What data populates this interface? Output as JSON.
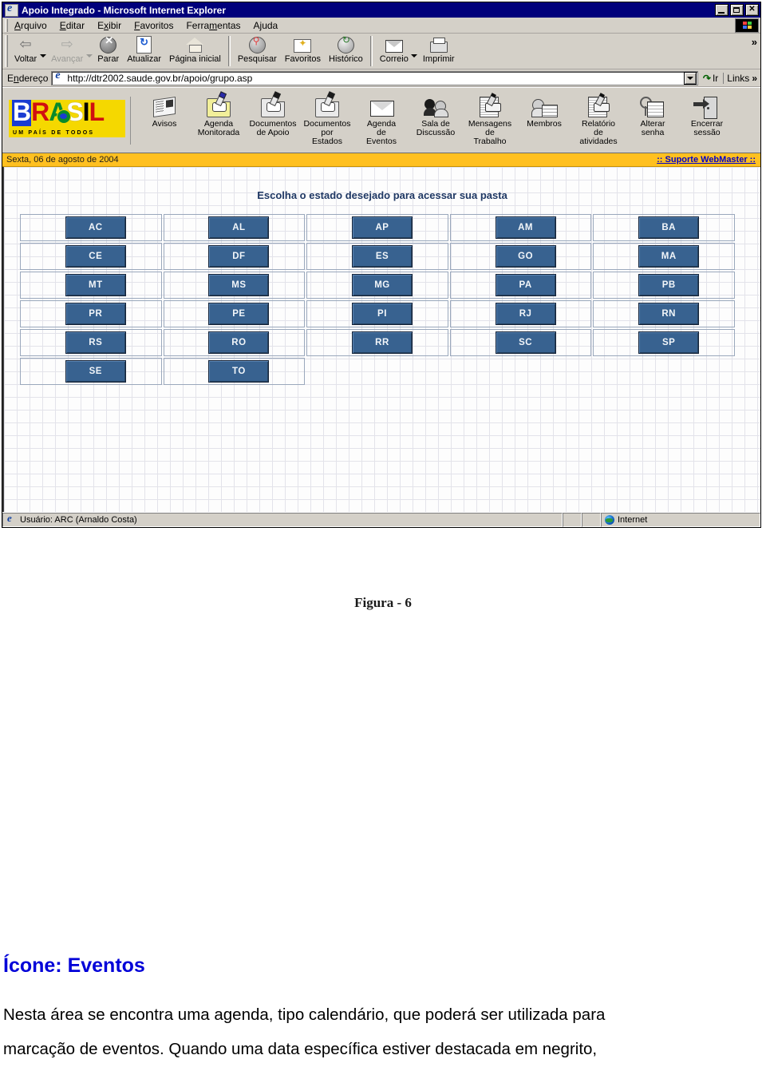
{
  "window": {
    "title": "Apoio Integrado - Microsoft Internet Explorer",
    "icon": "ie-document-icon",
    "controls": {
      "minimize": "minimize-button",
      "restore": "restore-button",
      "close": "close-button",
      "close_glyph": "✕"
    }
  },
  "menubar": {
    "items": [
      {
        "label": "Arquivo",
        "mnemonic": "A"
      },
      {
        "label": "Editar",
        "mnemonic": "E"
      },
      {
        "label": "Exibir",
        "mnemonic": "x"
      },
      {
        "label": "Favoritos",
        "mnemonic": "F"
      },
      {
        "label": "Ferramentas",
        "mnemonic": "m"
      },
      {
        "label": "Ajuda",
        "mnemonic": "j"
      }
    ],
    "logo_button": "ie-animated-logo"
  },
  "toolbar": {
    "buttons": [
      {
        "label": "Voltar",
        "icon": "back-arrow-icon",
        "enabled": true,
        "has_dropdown": true
      },
      {
        "label": "Avançar",
        "icon": "forward-arrow-icon",
        "enabled": false,
        "has_dropdown": true
      },
      {
        "label": "Parar",
        "icon": "stop-icon",
        "enabled": true,
        "has_dropdown": false
      },
      {
        "label": "Atualizar",
        "icon": "refresh-icon",
        "enabled": true,
        "has_dropdown": false
      },
      {
        "label": "Página inicial",
        "icon": "home-icon",
        "enabled": true,
        "has_dropdown": false
      },
      {
        "label": "Pesquisar",
        "icon": "search-icon",
        "enabled": true,
        "has_dropdown": false
      },
      {
        "label": "Favoritos",
        "icon": "favorites-star-folder-icon",
        "enabled": true,
        "has_dropdown": false
      },
      {
        "label": "Histórico",
        "icon": "history-clock-icon",
        "enabled": true,
        "has_dropdown": false
      },
      {
        "label": "Correio",
        "icon": "mail-icon",
        "enabled": true,
        "has_dropdown": true
      },
      {
        "label": "Imprimir",
        "icon": "printer-icon",
        "enabled": true,
        "has_dropdown": false
      }
    ],
    "overflow_chevron": "»"
  },
  "addressbar": {
    "label": "Endereço",
    "url": "http://dtr2002.saude.gov.br/apoio/grupo.asp",
    "go_label": "Ir",
    "go_arrow": "↷",
    "links_label": "Links",
    "links_chevron": "»",
    "icon": "ie-page-icon"
  },
  "app": {
    "logo": {
      "letters": [
        "B",
        "R",
        "A",
        "S",
        "I",
        "L"
      ],
      "subtitle": "UM PAÍS DE TODOS",
      "name": "brasil-government-logo"
    },
    "icons": [
      {
        "label": "Avisos",
        "icon": "newspaper-icon",
        "lines": [
          "Avisos"
        ]
      },
      {
        "label": "Agenda Monitorada",
        "icon": "yellow-folder-pen-icon",
        "lines": [
          "Agenda",
          "Monitorada"
        ]
      },
      {
        "label": "Documentos de Apoio",
        "icon": "folder-pen-icon",
        "lines": [
          "Documentos",
          "de Apoio"
        ]
      },
      {
        "label": "Documentos por Estados",
        "icon": "folder-pen-icon",
        "lines": [
          "Documentos",
          "por",
          "Estados"
        ]
      },
      {
        "label": "Agenda de Eventos",
        "icon": "envelope-icon",
        "lines": [
          "Agenda",
          "de",
          "Eventos"
        ]
      },
      {
        "label": "Sala de Discussão",
        "icon": "two-people-icon",
        "lines": [
          "Sala de",
          "Discussão"
        ]
      },
      {
        "label": "Mensagens de Trabalho",
        "icon": "document-hand-pen-icon",
        "lines": [
          "Mensagens",
          "de",
          "Trabalho"
        ]
      },
      {
        "label": "Membros",
        "icon": "member-list-icon",
        "lines": [
          "Membros"
        ]
      },
      {
        "label": "Relatório de atividades",
        "icon": "document-hand-pen-icon",
        "lines": [
          "Relatório",
          "de",
          "atividades"
        ]
      },
      {
        "label": "Alterar senha",
        "icon": "key-lock-icon",
        "lines": [
          "Alterar",
          "senha"
        ]
      },
      {
        "label": "Encerrar sessão",
        "icon": "exit-door-icon",
        "lines": [
          "Encerrar",
          "sessão"
        ]
      }
    ]
  },
  "datebar": {
    "date": "Sexta, 06 de agosto de 2004",
    "support_link": ":: Suporte WebMaster ::",
    "bg_color": "#ffc020",
    "link_color": "#0000c8"
  },
  "content": {
    "heading": "Escolha o estado desejado para acessar sua pasta",
    "heading_color": "#1f3864",
    "button_color": "#386290",
    "state_rows": [
      [
        "AC",
        "AL",
        "AP",
        "AM",
        "BA"
      ],
      [
        "CE",
        "DF",
        "ES",
        "GO",
        "MA"
      ],
      [
        "MT",
        "MS",
        "MG",
        "PA",
        "PB"
      ],
      [
        "PR",
        "PE",
        "PI",
        "RJ",
        "RN"
      ],
      [
        "RS",
        "RO",
        "RR",
        "SC",
        "SP"
      ],
      [
        "SE",
        "TO",
        "",
        "",
        ""
      ]
    ]
  },
  "statusbar": {
    "user_text": "Usuário: ARC (Arnaldo Costa)",
    "zone_text": "Internet",
    "user_icon": "ie-page-icon",
    "zone_icon": "internet-globe-icon"
  },
  "document": {
    "figure_caption": "Figura - 6",
    "section_heading": "Ícone: Eventos",
    "heading_color": "#0000d8",
    "paragraph_line1": "Nesta área se encontra uma agenda, tipo calendário, que poderá ser utilizada para",
    "paragraph_line2": "marcação de eventos. Quando uma data específica estiver destacada em negrito,"
  }
}
